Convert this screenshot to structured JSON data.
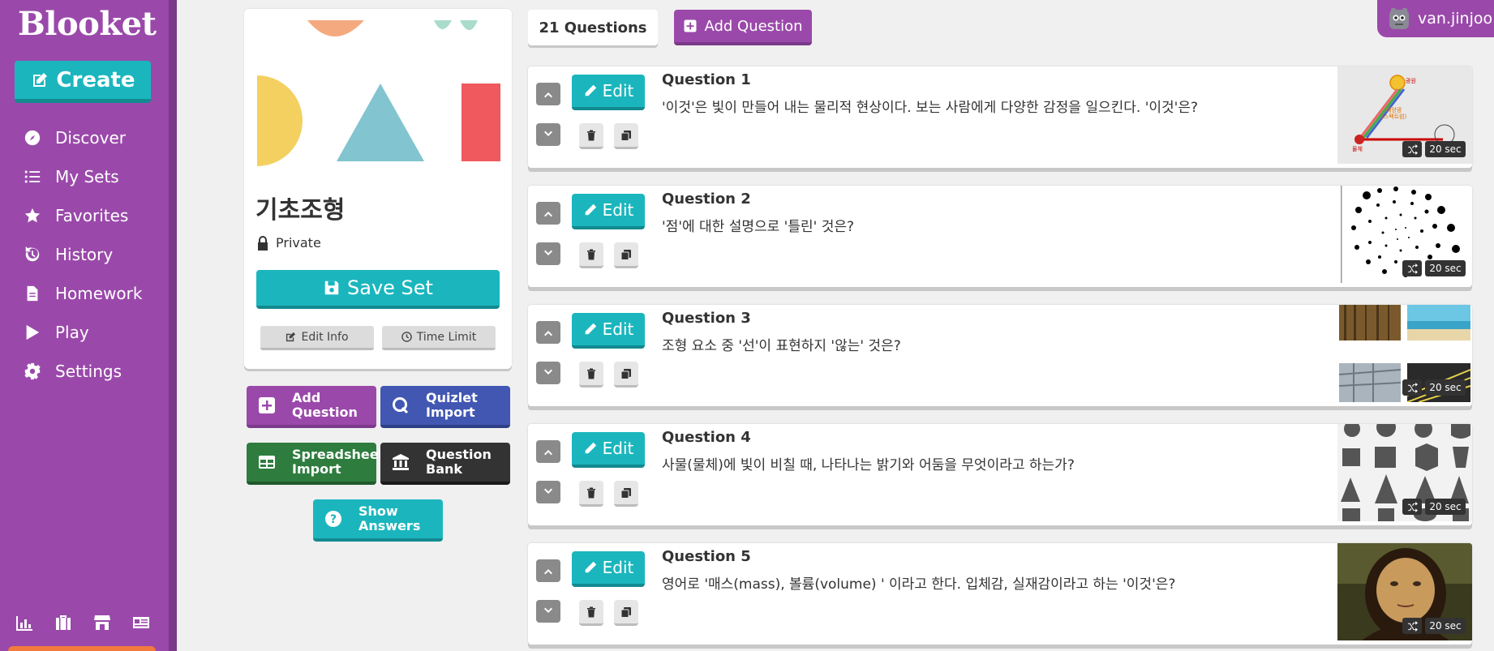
{
  "sidebar": {
    "logo": "Blooket",
    "create_label": "Create",
    "items": [
      {
        "label": "Discover",
        "icon": "compass-icon"
      },
      {
        "label": "My Sets",
        "icon": "list-icon"
      },
      {
        "label": "Favorites",
        "icon": "star-icon"
      },
      {
        "label": "History",
        "icon": "history-icon"
      },
      {
        "label": "Homework",
        "icon": "document-icon"
      },
      {
        "label": "Play",
        "icon": "play-icon"
      },
      {
        "label": "Settings",
        "icon": "gear-icon"
      }
    ],
    "bottom_icons": [
      "stats-icon",
      "briefcase-icon",
      "store-icon",
      "news-icon"
    ]
  },
  "set": {
    "title": "기초조형",
    "privacy": "Private",
    "save_label": "Save Set",
    "edit_info_label": "Edit Info",
    "time_limit_label": "Time Limit"
  },
  "actions": {
    "add_question": "Add Question",
    "quizlet_import": "Quizlet Import",
    "spreadsheet_import": "Spreadsheet Import",
    "question_bank": "Question Bank",
    "show_answers": "Show Answers"
  },
  "toolbar": {
    "question_count": "21 Questions",
    "add_question_label": "Add Question"
  },
  "user": {
    "name": "van.jinjoo"
  },
  "questions": [
    {
      "label": "Question 1",
      "text": "'이것'은 빛이 만들어 내는 물리적 현상이다. 보는 사람에게 다양한 감정을 일으킨다. '이것'은?",
      "time": "20 sec",
      "edit": "Edit"
    },
    {
      "label": "Question 2",
      "text": "'점'에 대한 설명으로 '틀린' 것은?",
      "time": "20 sec",
      "edit": "Edit"
    },
    {
      "label": "Question 3",
      "text": "조형 요소 중 '선'이 표현하지 '않는' 것은?",
      "time": "20 sec",
      "edit": "Edit"
    },
    {
      "label": "Question 4",
      "text": "사물(물체)에 빛이 비칠 때, 나타나는 밝기와 어둠을 무엇이라고 하는가?",
      "time": "20 sec",
      "edit": "Edit"
    },
    {
      "label": "Question 5",
      "text": "영어로 '매스(mass), 볼륨(volume) ' 이라고 한다. 입체감, 실재감이라고 하는 '이것'은?",
      "time": "20 sec",
      "edit": "Edit"
    }
  ],
  "colors": {
    "brand_purple": "#9a49aa",
    "teal": "#1bb6bd",
    "quizlet_blue": "#4257b2",
    "spreadsheet_green": "#2e7d3e",
    "question_bank_dark": "#333333"
  }
}
